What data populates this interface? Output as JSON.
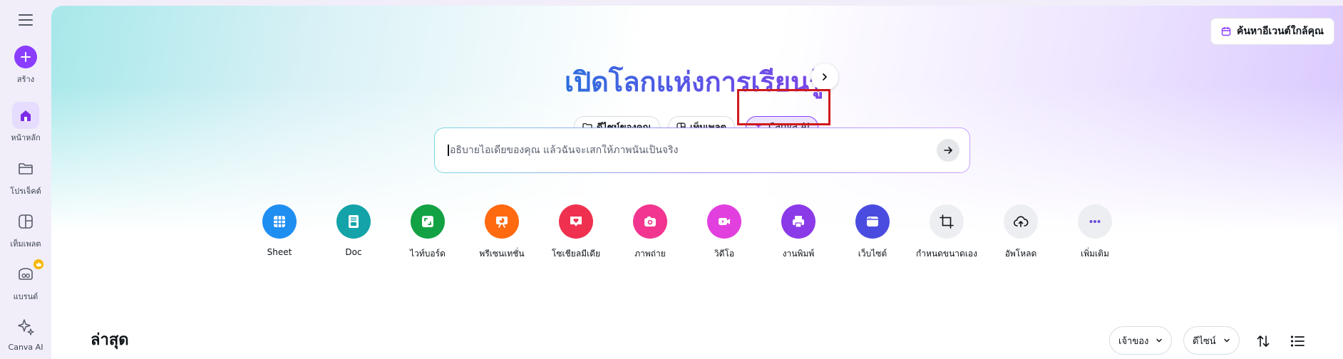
{
  "sidebar": {
    "menu_icon": "hamburger-icon",
    "items": [
      {
        "label": "สร้าง",
        "icon": "plus-icon"
      },
      {
        "label": "หน้าหลัก",
        "icon": "home-icon"
      },
      {
        "label": "โปรเจ็คต์",
        "icon": "folder-icon"
      },
      {
        "label": "เท็มเพลต",
        "icon": "template-icon"
      },
      {
        "label": "แบรนด์",
        "icon": "brand-icon"
      },
      {
        "label": "Canva AI",
        "icon": "sparkle-icon"
      }
    ],
    "accent_color": "#8b3dff"
  },
  "header": {
    "event_button": "ค้นหาอีเวนต์ใกล้คุณ",
    "hero_title": "เปิดโลกแห่งการเรียนรู้"
  },
  "tabs": [
    {
      "label": "ดีไซน์ของคุณ",
      "icon": "folder-icon",
      "active": false
    },
    {
      "label": "เท็มเพลต",
      "icon": "template-icon",
      "active": false
    },
    {
      "label": "Canva AI",
      "icon": "sparkle-icon",
      "active": true
    }
  ],
  "prompt": {
    "placeholder": "อธิบายไอเดียของคุณ แล้วฉันจะเสกให้ภาพนั้นเป็นจริง",
    "value": ""
  },
  "shortcuts": [
    {
      "label": "Sheet",
      "icon": "sheet-icon",
      "color": "#1f8ef1"
    },
    {
      "label": "Doc",
      "icon": "doc-icon",
      "color": "#13a3a8"
    },
    {
      "label": "ไวท์บอร์ด",
      "icon": "whiteboard-icon",
      "color": "#12a244"
    },
    {
      "label": "พรีเซนเทชั่น",
      "icon": "presentation-icon",
      "color": "#ff6a10"
    },
    {
      "label": "โซเชียลมีเดีย",
      "icon": "heart-icon",
      "color": "#f0304f"
    },
    {
      "label": "ภาพถ่าย",
      "icon": "camera-icon",
      "color": "#f2368f"
    },
    {
      "label": "วิดีโอ",
      "icon": "video-icon",
      "color": "#e240de"
    },
    {
      "label": "งานพิมพ์",
      "icon": "print-icon",
      "color": "#8b3ae8"
    },
    {
      "label": "เว็บไซต์",
      "icon": "website-icon",
      "color": "#4a4ce0"
    },
    {
      "label": "กำหนดขนาดเอง",
      "icon": "custom-size-icon",
      "color": "#eceef1"
    },
    {
      "label": "อัพโหลด",
      "icon": "upload-icon",
      "color": "#eceef1"
    },
    {
      "label": "เพิ่มเติม",
      "icon": "more-icon",
      "color": "#eceef1"
    }
  ],
  "recent": {
    "title": "ล่าสุด",
    "filters": [
      {
        "label": "เจ้าของ"
      },
      {
        "label": "ดีไซน์"
      }
    ]
  }
}
